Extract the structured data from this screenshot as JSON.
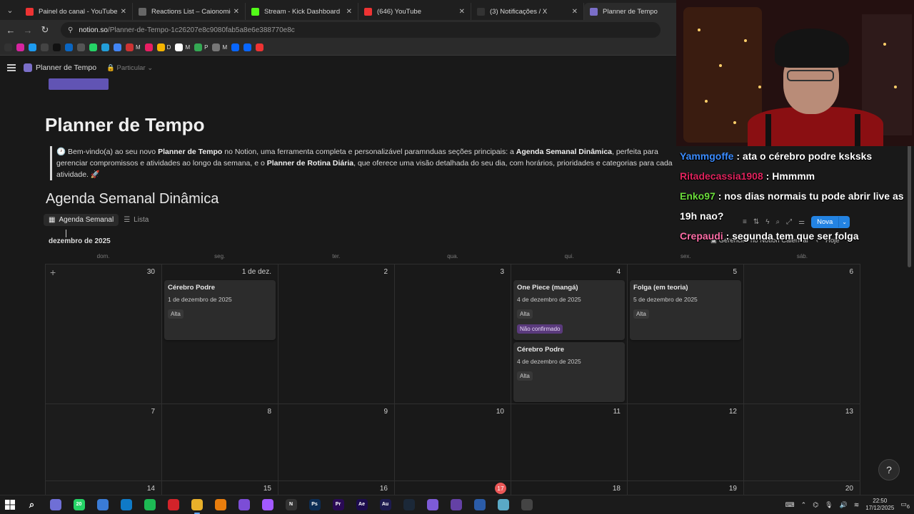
{
  "browser": {
    "tabs": [
      {
        "title": "Painel do canal - YouTube Studio",
        "color": "#e33"
      },
      {
        "title": "Reactions List – Caionomichi",
        "color": "#666"
      },
      {
        "title": "Stream - Kick Dashboard",
        "color": "#53fc18"
      },
      {
        "title": "(646) YouTube",
        "color": "#e33"
      },
      {
        "title": "(3) Notificações / X",
        "color": "#333"
      },
      {
        "title": "Planner de Tempo",
        "color": "#7b6fc9"
      }
    ],
    "url_domain": "notion.so",
    "url_path": "/Planner-de-Tempo-1c26207e8c9080fab5a8e6e388770e8c"
  },
  "bookmarks": {
    "items": [
      {
        "color": "#333"
      },
      {
        "color": "#d6249f"
      },
      {
        "color": "#1d9bf0"
      },
      {
        "color": "#444"
      },
      {
        "color": "#111"
      },
      {
        "color": "#0a66c2"
      },
      {
        "color": "#555"
      },
      {
        "color": "#25d366"
      },
      {
        "color": "#229ed9"
      },
      {
        "color": "#4285f4"
      },
      {
        "color": "#c33"
      },
      {
        "color": "#e91e63"
      },
      {
        "color": "#f4b400"
      },
      {
        "color": "#fff"
      },
      {
        "color": "#34a853"
      },
      {
        "color": "#777"
      },
      {
        "color": "#0866ff"
      },
      {
        "color": "#0866ff"
      },
      {
        "color": "#e33"
      }
    ],
    "labels": [
      "M",
      "D",
      "M",
      "P",
      "M"
    ]
  },
  "notion": {
    "page_title_crumb": "Planner de Tempo",
    "privacy": "Particular",
    "title": "Planner de Tempo",
    "callout": {
      "p1": " Bem-vindo(a) ao seu novo ",
      "b1": "Planner de Tempo",
      "p2": " no Notion, uma ferramenta completa e personalizável paramnduas seções principais: a ",
      "b2": "Agenda Semanal Dinâmica",
      "p3": ", perfeita para gerenciar compromissos e atividades ao longo da semana, e o ",
      "b3": "Planner de Rotina Diária",
      "p4": ", que oferece uma visão detalhada do seu dia, com horários, prioridades e categorias para cada atividade. 🚀"
    },
    "section_title": "Agenda Semanal Dinâmica",
    "views": [
      "Agenda Semanal",
      "Lista"
    ],
    "month_label": "dezembro de 2025",
    "new_button": "Nova",
    "manage_calendar": "Gerenciar no Notion Calendar",
    "today_button": "Hoje",
    "weekdays": [
      "dom.",
      "seg.",
      "ter.",
      "qua.",
      "qui.",
      "sex.",
      "sáb."
    ],
    "weeks": [
      [
        {
          "day": "30",
          "cards": []
        },
        {
          "day": "1 de dez.",
          "cards": [
            {
              "title": "Cérebro Podre",
              "date": "1 de dezembro de 2025",
              "priority": "Alta",
              "status": ""
            }
          ]
        },
        {
          "day": "2",
          "cards": []
        },
        {
          "day": "3",
          "cards": []
        },
        {
          "day": "4",
          "cards": [
            {
              "title": "One Piece (mangá)",
              "date": "4 de dezembro de 2025",
              "priority": "Alta",
              "status": "Não confirmado"
            },
            {
              "title": "Cérebro Podre",
              "date": "4 de dezembro de 2025",
              "priority": "Alta",
              "status": ""
            }
          ]
        },
        {
          "day": "5",
          "cards": [
            {
              "title": "Folga (em teoria)",
              "date": "5 de dezembro de 2025",
              "priority": "Alta",
              "status": ""
            }
          ]
        },
        {
          "day": "6",
          "cards": []
        }
      ],
      [
        {
          "day": "7"
        },
        {
          "day": "8"
        },
        {
          "day": "9"
        },
        {
          "day": "10"
        },
        {
          "day": "11"
        },
        {
          "day": "12"
        },
        {
          "day": "13"
        }
      ],
      [
        {
          "day": "14"
        },
        {
          "day": "15"
        },
        {
          "day": "16"
        },
        {
          "day": "17",
          "today": true
        },
        {
          "day": "18"
        },
        {
          "day": "19"
        },
        {
          "day": "20"
        }
      ]
    ]
  },
  "chat": [
    {
      "user": "Yammgoffe",
      "text": " : ata o cérebro podre ksksks",
      "color": "#3b8cff"
    },
    {
      "user": "Ritadecassia1908",
      "text": " : Hmmmm",
      "color": "#e0245e"
    },
    {
      "user": "Enko97",
      "text": " : nos dias normais tu pode abrir live as 19h nao?",
      "color": "#6cde3c"
    },
    {
      "user": "Crepaudi",
      "text": " : segunda tem que ser folga",
      "color": "#ff6fa8"
    }
  ],
  "taskbar": {
    "apps": [
      {
        "name": "chrome-ai",
        "color": "#6f6fd6",
        "label": ""
      },
      {
        "name": "whatsapp",
        "color": "#25d366",
        "label": "20"
      },
      {
        "name": "copilot",
        "color": "#3a7bd5",
        "label": ""
      },
      {
        "name": "edge",
        "color": "#0f7ac7",
        "label": ""
      },
      {
        "name": "spotify",
        "color": "#1db954",
        "label": ""
      },
      {
        "name": "opera",
        "color": "#d3232a",
        "label": ""
      },
      {
        "name": "chrome",
        "color": "#e8b02a",
        "label": "",
        "active": true
      },
      {
        "name": "blender",
        "color": "#e87d0d",
        "label": ""
      },
      {
        "name": "obsidian",
        "color": "#7c4dd6",
        "label": ""
      },
      {
        "name": "figma",
        "color": "#a259ff",
        "label": ""
      },
      {
        "name": "notion",
        "color": "#333",
        "label": "N"
      },
      {
        "name": "photoshop",
        "color": "#0c2d55",
        "label": "Ps"
      },
      {
        "name": "premiere",
        "color": "#2a0a55",
        "label": "Pr"
      },
      {
        "name": "after-effects",
        "color": "#1c0b4d",
        "label": "Ae"
      },
      {
        "name": "audition",
        "color": "#1d1b4f",
        "label": "Au"
      },
      {
        "name": "steam",
        "color": "#1b2838",
        "label": ""
      },
      {
        "name": "discord-like",
        "color": "#7d5bd6",
        "label": ""
      },
      {
        "name": "twitch",
        "color": "#6441a5",
        "label": ""
      },
      {
        "name": "kick-studio",
        "color": "#2b5ca8",
        "label": ""
      },
      {
        "name": "files",
        "color": "#5aa9c6",
        "label": ""
      },
      {
        "name": "obs",
        "color": "#444",
        "label": ""
      }
    ],
    "time": "22:50",
    "date": "17/12/2025",
    "notifications": "6"
  }
}
